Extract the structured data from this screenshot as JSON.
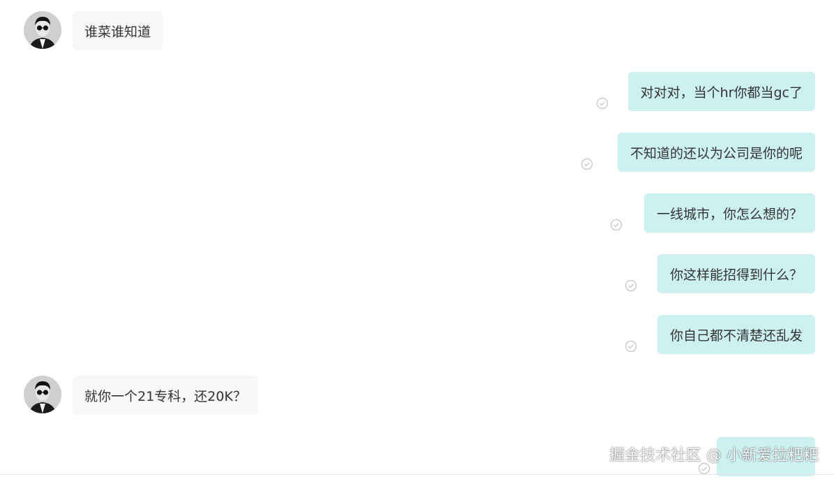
{
  "messages": [
    {
      "from": "other",
      "text": "谁菜谁知道"
    },
    {
      "from": "me",
      "text": "对对对，当个hr你都当gc了"
    },
    {
      "from": "me",
      "text": "不知道的还以为公司是你的呢"
    },
    {
      "from": "me",
      "text": "一线城市，你怎么想的？"
    },
    {
      "from": "me",
      "text": "你这样能招得到什么？"
    },
    {
      "from": "me",
      "text": "你自己都不清楚还乱发"
    },
    {
      "from": "other",
      "text": "就你一个21专科，还20K？"
    },
    {
      "from": "me",
      "text": ""
    }
  ],
  "watermark": "掘金技术社区 @ 小新爱拉粑粑",
  "colors": {
    "incoming_bubble": "#f7f7f7",
    "outgoing_bubble": "#cdf0f0",
    "text": "#333333",
    "read_check": "#cccccc"
  },
  "icons": {
    "avatar": "avatar-sunglasses-man",
    "read_receipt": "check-circle-icon"
  }
}
